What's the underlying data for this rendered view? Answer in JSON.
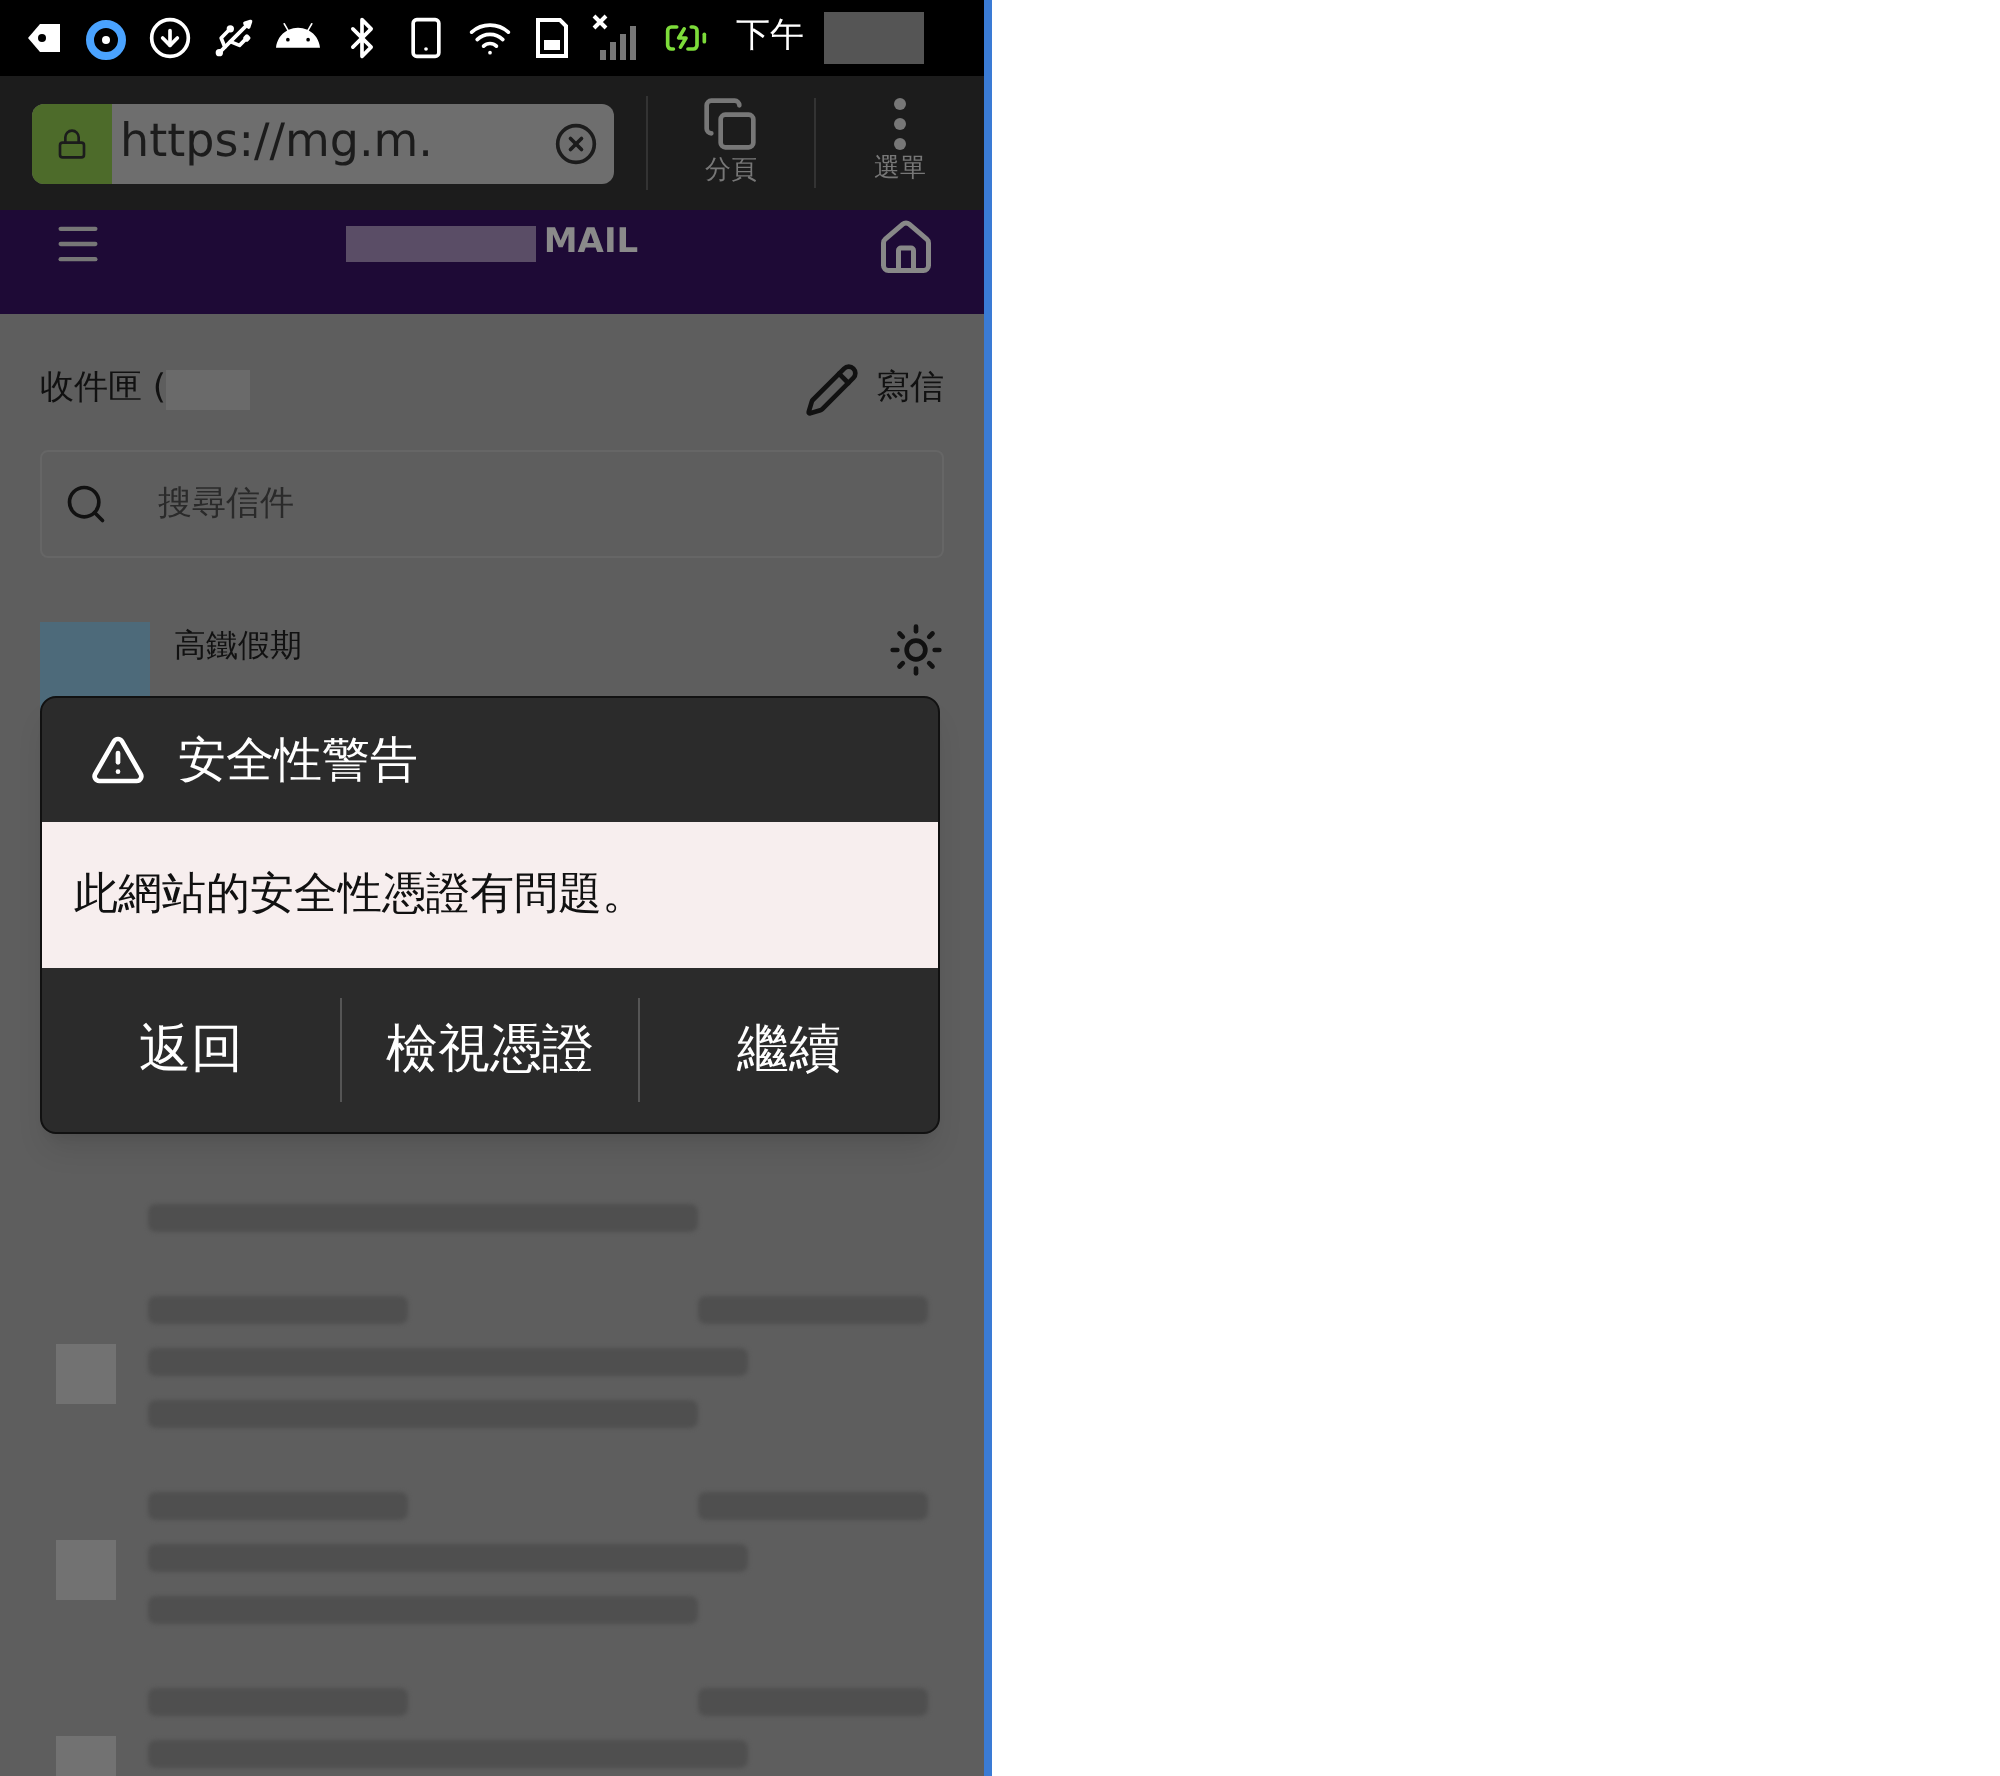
{
  "status_bar": {
    "time": "下午"
  },
  "browser": {
    "url": "https://mg.m.",
    "tabs_label": "分頁",
    "menu_label": "選單"
  },
  "header": {
    "logo_text": "MAIL"
  },
  "inbox": {
    "title": "收件匣 (",
    "compose": "寫信",
    "search_placeholder": "搜尋信件",
    "first_mail": {
      "subject": "高鐵假期"
    }
  },
  "dialog": {
    "title": "安全性警告",
    "message": "此網站的安全性憑證有問題。",
    "buttons": [
      "返回",
      "檢視憑證",
      "繼續"
    ]
  }
}
